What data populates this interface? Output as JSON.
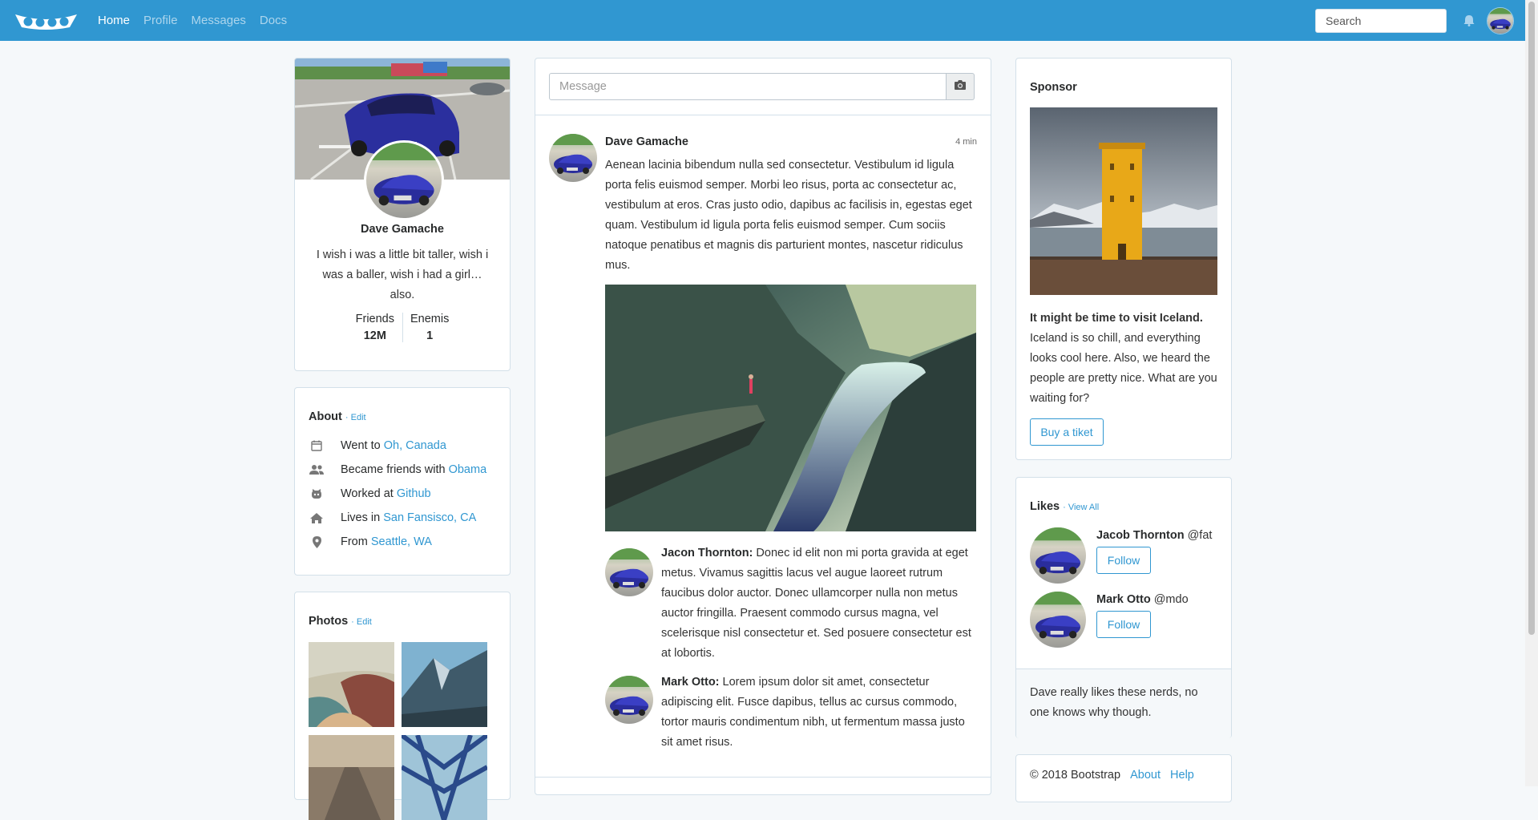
{
  "navbar": {
    "brand": "Bootstrap",
    "links": [
      "Home",
      "Profile",
      "Messages",
      "Docs"
    ],
    "active": "Home",
    "search_placeholder": "Search",
    "brand_color": "#3097d1"
  },
  "profile": {
    "name": "Dave Gamache",
    "bio": "I wish i was a little bit taller, wish i was a baller, wish i had a girl… also.",
    "friends_label": "Friends",
    "friends_count": "12M",
    "enemies_label": "Enemis",
    "enemies_count": "1"
  },
  "about": {
    "title": "About",
    "edit": "· Edit",
    "items": [
      {
        "icon": "calendar-icon",
        "text": "Went to ",
        "link": "Oh, Canada"
      },
      {
        "icon": "users-icon",
        "text": "Became friends with ",
        "link": "Obama"
      },
      {
        "icon": "github-icon",
        "text": "Worked at ",
        "link": "Github"
      },
      {
        "icon": "home-icon",
        "text": "Lives in ",
        "link": "San Fansisco, CA"
      },
      {
        "icon": "location-icon",
        "text": "From ",
        "link": "Seattle, WA"
      }
    ]
  },
  "photos": {
    "title": "Photos",
    "edit": "· Edit"
  },
  "composer": {
    "placeholder": "Message"
  },
  "post": {
    "author": "Dave Gamache",
    "time": "4 min",
    "body": "Aenean lacinia bibendum nulla sed consectetur. Vestibulum id ligula porta felis euismod semper. Morbi leo risus, porta ac consectetur ac, vestibulum at eros. Cras justo odio, dapibus ac facilisis in, egestas eget quam. Vestibulum id ligula porta felis euismod semper. Cum sociis natoque penatibus et magnis dis parturient montes, nascetur ridiculus mus.",
    "replies": [
      {
        "author": "Jacon Thornton:",
        "text": " Donec id elit non mi porta gravida at eget metus. Vivamus sagittis lacus vel augue laoreet rutrum faucibus dolor auctor. Donec ullamcorper nulla non metus auctor fringilla. Praesent commodo cursus magna, vel scelerisque nisl consectetur et. Sed posuere consectetur est at lobortis."
      },
      {
        "author": "Mark Otto:",
        "text": " Lorem ipsum dolor sit amet, consectetur adipiscing elit. Fusce dapibus, tellus ac cursus commodo, tortor mauris condimentum nibh, ut fermentum massa justo sit amet risus."
      }
    ]
  },
  "sponsor": {
    "title": "Sponsor",
    "headline": "It might be time to visit Iceland.",
    "text": " Iceland is so chill, and everything looks cool here. Also, we heard the people are pretty nice. What are you waiting for?",
    "button": "Buy a tiket"
  },
  "likes": {
    "title": "Likes",
    "view_all": "· View All",
    "people": [
      {
        "name": "Jacob Thornton",
        "handle": " @fat",
        "button": "Follow"
      },
      {
        "name": "Mark Otto",
        "handle": " @mdo",
        "button": "Follow"
      }
    ],
    "footer": "Dave really likes these nerds, no one knows why though."
  },
  "footer": {
    "copyright": "© 2018 Bootstrap",
    "links": [
      "About",
      "Help"
    ]
  }
}
